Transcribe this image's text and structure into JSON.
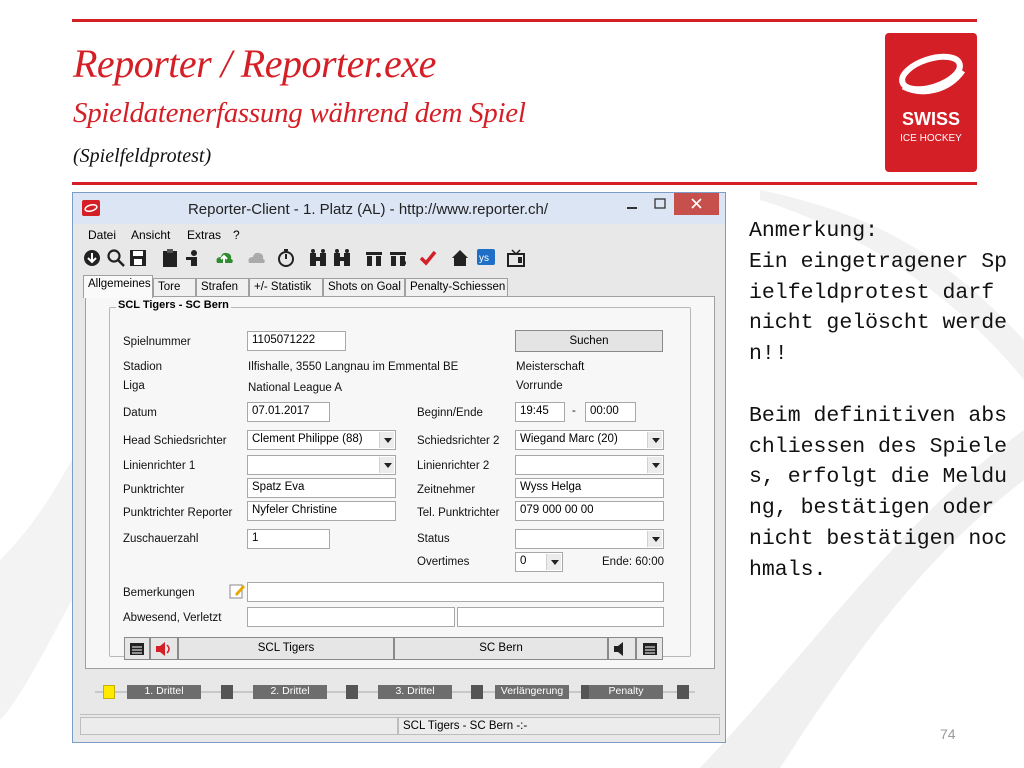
{
  "slide": {
    "title": "Reporter / Reporter.exe",
    "subtitle": "Spieldatenerfassung während dem Spiel",
    "paren": "(Spielfeldprotest)",
    "page_number": "74",
    "note": "Anmerkung:\nEin eingetragener Spielfeldprotest darf nicht gelöscht werden!!\n\nBeim definitiven abschliessen des Spieles, erfolgt die Meldung, bestätigen oder nicht bestätigen nochmals.",
    "accent_color": "#d41f26",
    "logo": {
      "line1": "SWISS",
      "line2": "ICE HOCKEY"
    }
  },
  "window": {
    "title": "Reporter-Client  -  1. Platz (AL)  -  http://www.reporter.ch/",
    "menu": [
      "Datei",
      "Ansicht",
      "Extras",
      "?"
    ],
    "toolbar_icons": [
      "download-icon",
      "search-icon",
      "save-icon",
      "clipboard-icon",
      "player-icon",
      "upload-icon",
      "cloud-icon",
      "stopwatch-icon",
      "team-home-icon",
      "team-away-icon",
      "lineup-home-icon",
      "lineup-away-icon",
      "check-icon",
      "home-icon",
      "ys-icon",
      "tv-icon"
    ],
    "tabs": [
      "Allgemeines",
      "Tore",
      "Strafen",
      "+/- Statistik",
      "Shots on Goal",
      "Penalty-Schiessen"
    ],
    "active_tab": "Allgemeines",
    "group_title": "SCL Tigers - SC Bern",
    "form": {
      "spielnummer_label": "Spielnummer",
      "spielnummer": "1105071222",
      "suchen_label": "Suchen",
      "stadion_label": "Stadion",
      "stadion": "Ilfishalle, 3550 Langnau im Emmental BE",
      "meisterschaft": "Meisterschaft",
      "liga_label": "Liga",
      "liga": "National League A",
      "vorrunde": "Vorrunde",
      "datum_label": "Datum",
      "datum": "07.01.2017",
      "beginn_label": "Beginn/Ende",
      "beginn": "19:45",
      "dash": "-",
      "ende": "00:00",
      "head_label": "Head Schiedsrichter",
      "head": "Clement Philippe (88)",
      "sr2_label": "Schiedsrichter 2",
      "sr2": "Wiegand Marc (20)",
      "lr1_label": "Linienrichter 1",
      "lr1": "",
      "lr2_label": "Linienrichter 2",
      "lr2": "",
      "punkt_label": "Punktrichter",
      "punkt": "Spatz Eva",
      "zeit_label": "Zeitnehmer",
      "zeit": "Wyss Helga",
      "punktrep_label": "Punktrichter Reporter",
      "punktrep": "Nyfeler Christine",
      "tel_label": "Tel. Punktrichter",
      "tel": "079 000 00 00",
      "zuschauer_label": "Zuschauerzahl",
      "zuschauer": "1",
      "status_label": "Status",
      "status": "",
      "overtimes_label": "Overtimes",
      "overtimes": "0",
      "ende_info": "Ende: 60:00",
      "bemerkungen_label": "Bemerkungen",
      "bemerkungen": "",
      "abwesend_label": "Abwesend, Verletzt",
      "abwesend_home": "",
      "abwesend_away": ""
    },
    "teams": {
      "home": "SCL Tigers",
      "away": "SC Bern"
    },
    "periods": [
      "1. Drittel",
      "2. Drittel",
      "3. Drittel",
      "Verlängerung",
      "Penalty"
    ],
    "status_text": "SCL Tigers - SC Bern -:-"
  }
}
